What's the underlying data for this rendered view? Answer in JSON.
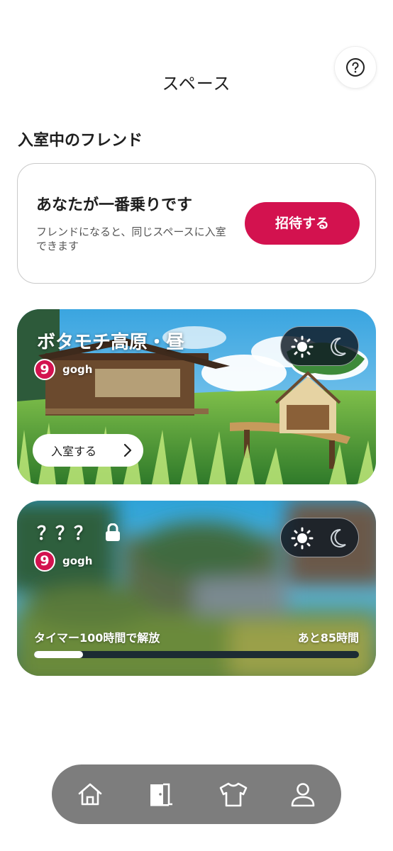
{
  "header": {
    "title": "スペース",
    "help_icon": "question-circle-icon"
  },
  "section_title": "入室中のフレンド",
  "first_card": {
    "heading": "あなたが一番乗りです",
    "description": "フレンドになると、同じスペースに入室できます",
    "invite_label": "招待する"
  },
  "spaces": [
    {
      "name": "ボタモチ高原・昼",
      "owner_badge": "9",
      "owner_name": "gogh",
      "enter_label": "入室する",
      "toggle": {
        "selected": "day",
        "icons": [
          "sun-icon",
          "moon-icon"
        ]
      }
    },
    {
      "name": "？？？",
      "locked": true,
      "owner_badge": "9",
      "owner_name": "gogh",
      "timer_label": "タイマー100時間で解放",
      "remaining_label": "あと85時間",
      "progress": 0.15,
      "toggle": {
        "selected": "day",
        "icons": [
          "sun-icon",
          "moon-icon"
        ]
      }
    }
  ],
  "bottom_nav": {
    "items": [
      "home-icon",
      "space-door-icon",
      "closet-shirt-icon",
      "profile-icon"
    ],
    "active": "space-door-icon"
  },
  "colors": {
    "accent": "#d3124f",
    "nav_bg": "#7d7d7d",
    "toggle_bg": "#0f1923"
  }
}
